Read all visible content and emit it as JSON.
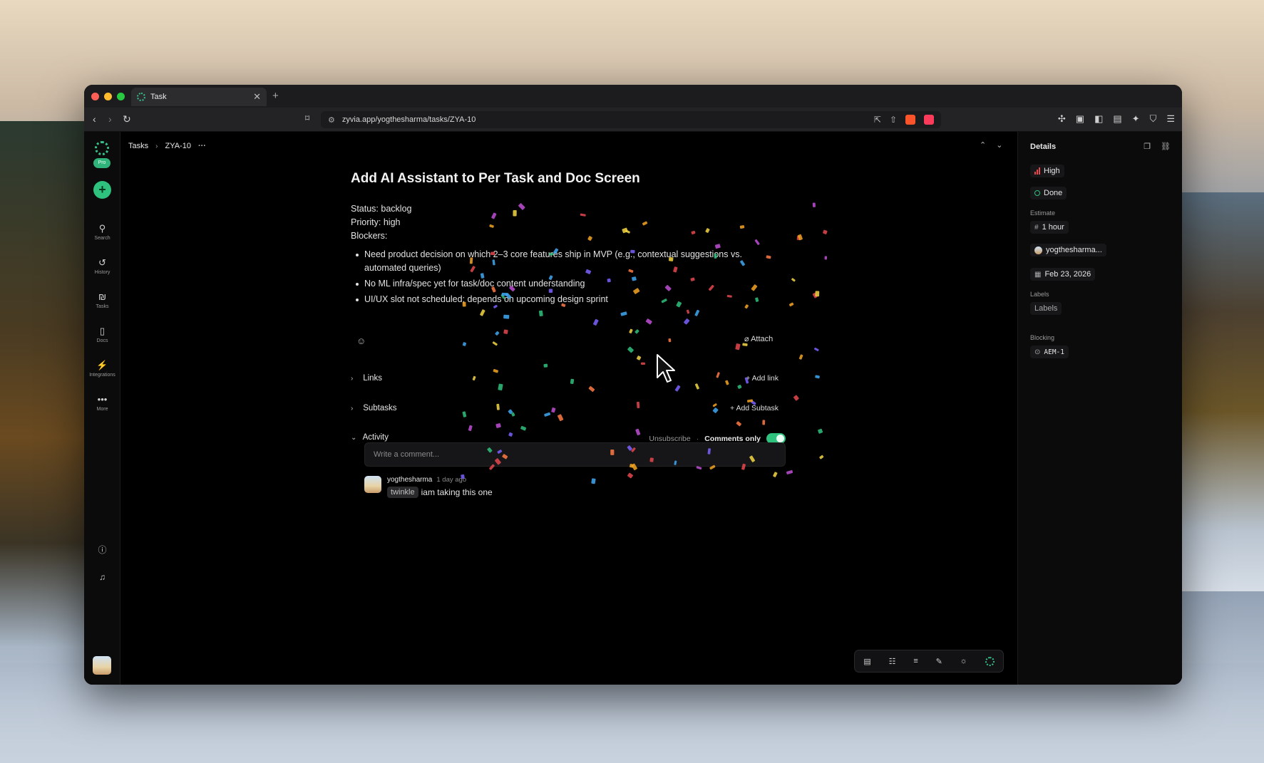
{
  "browser": {
    "tab_title": "Task",
    "new_tab_icon": "plus-icon",
    "url": "zyvia.app/yogthesharma/tasks/ZYA-10"
  },
  "rail": {
    "pro_badge": "Pro",
    "items": [
      {
        "label": "Search",
        "icon": "search-icon",
        "glyph": "⚲"
      },
      {
        "label": "History",
        "icon": "history-icon",
        "glyph": "↺"
      },
      {
        "label": "Tasks",
        "icon": "tasks-icon",
        "glyph": "₪"
      },
      {
        "label": "Docs",
        "icon": "docs-icon",
        "glyph": "▯"
      },
      {
        "label": "Integrations",
        "icon": "plug-icon",
        "glyph": "⚡"
      },
      {
        "label": "More",
        "icon": "more-icon",
        "glyph": "•••"
      }
    ]
  },
  "breadcrumb": {
    "root": "Tasks",
    "current": "ZYA-10"
  },
  "task": {
    "title": "Add AI Assistant to Per Task and Doc Screen",
    "status_line": "Status: backlog",
    "priority_line": "Priority: high",
    "blockers_line": "Blockers:",
    "bullets": [
      "Need product decision on which 2–3 core features ship in MVP (e.g., contextual suggestions vs. automated queries)",
      "No ML infra/spec yet for task/doc content understanding",
      "UI/UX slot not scheduled; depends on upcoming design sprint"
    ],
    "attach_label": "Attach",
    "links_label": "Links",
    "add_link_label": "Add link",
    "subtasks_label": "Subtasks",
    "add_subtask_label": "Add Subtask",
    "activity_label": "Activity",
    "unsubscribe_label": "Unsubscribe",
    "comments_only_label": "Comments only",
    "comment_placeholder": "Write a comment..."
  },
  "comment": {
    "author": "yogthesharma",
    "time": "1 day ago",
    "mention": "twinkle",
    "text": "iam taking this one"
  },
  "details": {
    "title": "Details",
    "priority": "High",
    "status": "Done",
    "estimate_label": "Estimate",
    "estimate": "1 hour",
    "assignee": "yogthesharma...",
    "due_date": "Feb 23, 2026",
    "labels_label": "Labels",
    "labels_value": "Labels",
    "blocking_label": "Blocking",
    "blocking_value": "AEM-1"
  },
  "colors": {
    "accent": "#2ec27e",
    "priority_high": "#e5484d"
  }
}
